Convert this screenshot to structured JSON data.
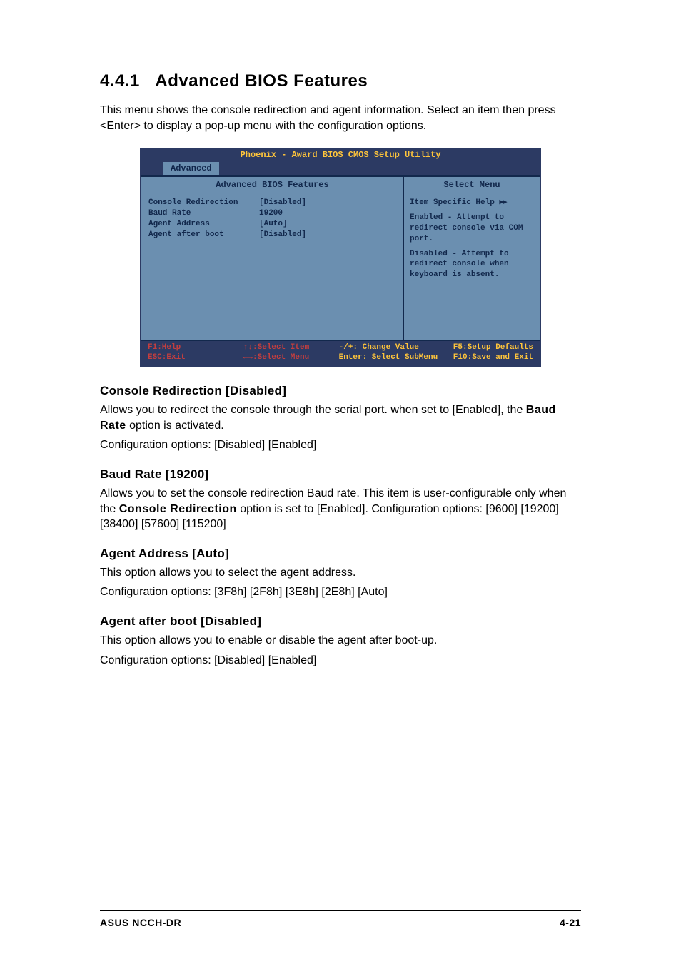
{
  "section": {
    "number": "4.4.1",
    "title": "Advanced BIOS Features",
    "intro": "This menu shows the console redirection and agent information. Select an item then press <Enter> to display a pop-up menu with the configuration options."
  },
  "bios": {
    "title": "Phoenix - Award BIOS CMOS Setup Utility",
    "tab": "Advanced",
    "left_header": "Advanced BIOS Features",
    "right_header": "Select Menu",
    "rows": [
      {
        "label": "Console Redirection",
        "value": "[Disabled]"
      },
      {
        "label": "Baud Rate",
        "value": "19200"
      },
      {
        "label": "Agent Address",
        "value": "[Auto]"
      },
      {
        "label": "Agent after boot",
        "value": "[Disabled]"
      }
    ],
    "help": {
      "line1": "Item Specific Help ",
      "arrows": "▶▶",
      "p1": "Enabled - Attempt to redirect console via COM port.",
      "p2": "Disabled - Attempt to redirect console when keyboard is absent."
    },
    "footer": {
      "c1a": "F1:Help",
      "c1b": "ESC:Exit",
      "c2a": "↑↓:Select Item",
      "c2b": "←→:Select Menu",
      "c3a": "-/+: Change Value",
      "c3b": "Enter: Select SubMenu",
      "c4a": "F5:Setup Defaults",
      "c4b": "F10:Save and Exit"
    }
  },
  "items": {
    "console_redirection": {
      "heading": "Console Redirection [Disabled]",
      "p1a": "Allows you to redirect the console through the serial port. when set to [Enabled], the ",
      "bold": "Baud Rate",
      "p1b": " option is activated.",
      "p2": "Configuration options: [Disabled] [Enabled]"
    },
    "baud_rate": {
      "heading": "Baud Rate [19200]",
      "p1a": "Allows you to set the console redirection Baud rate. This item is user-configurable only when the ",
      "bold": "Console Redirection",
      "p1b": " option is set to [Enabled]. Configuration options: [9600] [19200] [38400] [57600] [115200]"
    },
    "agent_address": {
      "heading": "Agent Address [Auto]",
      "p1": "This option allows you to select the agent address.",
      "p2": "Configuration options: [3F8h] [2F8h] [3E8h] [2E8h] [Auto]"
    },
    "agent_after_boot": {
      "heading": "Agent after boot [Disabled]",
      "p1": "This option allows you to enable or disable the agent after boot-up.",
      "p2": "Configuration options: [Disabled] [Enabled]"
    }
  },
  "footer": {
    "left": "ASUS NCCH-DR",
    "right": "4-21"
  }
}
